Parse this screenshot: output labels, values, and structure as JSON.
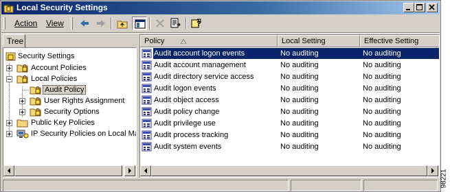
{
  "window": {
    "title": "Local Security Settings"
  },
  "menu": {
    "action_label": "Action",
    "view_label": "View"
  },
  "tree": {
    "tab_label": "Tree",
    "nodes": [
      {
        "label": "Security Settings"
      },
      {
        "label": "Account Policies"
      },
      {
        "label": "Local Policies"
      },
      {
        "label": "Audit Policy"
      },
      {
        "label": "User Rights Assignment"
      },
      {
        "label": "Security Options"
      },
      {
        "label": "Public Key Policies"
      },
      {
        "label": "IP Security Policies on Local Mac"
      }
    ]
  },
  "list": {
    "columns": [
      "Policy",
      "Local Setting",
      "Effective Setting"
    ],
    "rows": [
      {
        "policy": "Audit account logon events",
        "local": "No auditing",
        "effective": "No auditing"
      },
      {
        "policy": "Audit account management",
        "local": "No auditing",
        "effective": "No auditing"
      },
      {
        "policy": "Audit directory service access",
        "local": "No auditing",
        "effective": "No auditing"
      },
      {
        "policy": "Audit logon events",
        "local": "No auditing",
        "effective": "No auditing"
      },
      {
        "policy": "Audit object access",
        "local": "No auditing",
        "effective": "No auditing"
      },
      {
        "policy": "Audit policy change",
        "local": "No auditing",
        "effective": "No auditing"
      },
      {
        "policy": "Audit privilege use",
        "local": "No auditing",
        "effective": "No auditing"
      },
      {
        "policy": "Audit process tracking",
        "local": "No auditing",
        "effective": "No auditing"
      },
      {
        "policy": "Audit system events",
        "local": "No auditing",
        "effective": "No auditing"
      }
    ]
  },
  "figure_id": "98221",
  "colors": {
    "titlebar_start": "#0a246a",
    "titlebar_end": "#a6caf0",
    "selection": "#0a246a",
    "chrome": "#d4d0c8"
  },
  "icons": [
    "app-icon",
    "minimize-icon",
    "maximize-icon",
    "close-icon",
    "back-arrow-icon",
    "forward-arrow-icon",
    "up-folder-icon",
    "show-hide-tree-icon",
    "delete-icon",
    "export-list-icon",
    "help-icon",
    "folder-icon",
    "lock-folder-icon",
    "policy-icon"
  ]
}
